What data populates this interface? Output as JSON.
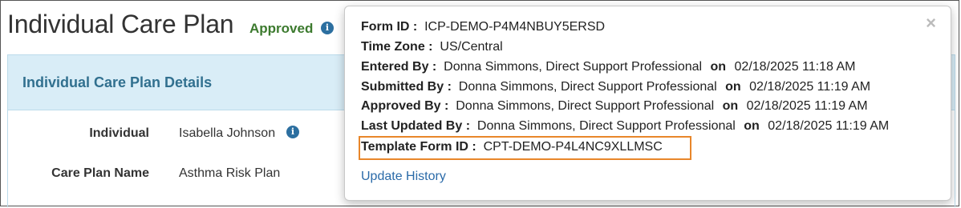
{
  "page": {
    "title": "Individual Care Plan",
    "status": "Approved",
    "status_color": "#3c7a2e"
  },
  "panel": {
    "title": "Individual Care Plan Details",
    "rows": [
      {
        "label": "Individual",
        "value": "Isabella Johnson"
      },
      {
        "label": "Care Plan Name",
        "value": "Asthma Risk Plan"
      }
    ]
  },
  "popover": {
    "close": "×",
    "form_id": {
      "label": "Form ID :",
      "value": "ICP-DEMO-P4M4NBUY5ERSD"
    },
    "time_zone": {
      "label": "Time Zone :",
      "value": "US/Central"
    },
    "entered_by": {
      "label": "Entered By :",
      "who": "Donna Simmons, Direct Support Professional",
      "on": "on",
      "when": "02/18/2025 11:18 AM"
    },
    "submitted_by": {
      "label": "Submitted By :",
      "who": "Donna Simmons, Direct Support Professional",
      "on": "on",
      "when": "02/18/2025 11:19 AM"
    },
    "approved_by": {
      "label": "Approved By :",
      "who": "Donna Simmons, Direct Support Professional",
      "on": "on",
      "when": "02/18/2025 11:19 AM"
    },
    "last_updated_by": {
      "label": "Last Updated By :",
      "who": "Donna Simmons, Direct Support Professional",
      "on": "on",
      "when": "02/18/2025 11:19 AM"
    },
    "template_form_id": {
      "label": "Template Form ID :",
      "value": "CPT-DEMO-P4L4NC9XLLMSC"
    },
    "update_history": "Update History",
    "highlight_color": "#e8862a"
  },
  "icons": {
    "info": "info-icon",
    "close": "close-icon"
  }
}
